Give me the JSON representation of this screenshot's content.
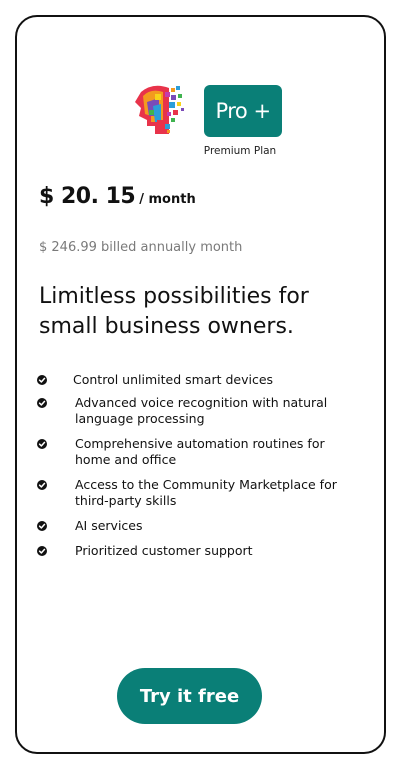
{
  "plan": {
    "badge_label": "Pro +",
    "caption": "Premium Plan"
  },
  "pricing": {
    "amount": "$ 20. 15",
    "period": "/ month",
    "billed": "$ 246.99 billed annually month"
  },
  "headline": "Limitless possibilities for small business owners.",
  "features": [
    "Control unlimited smart devices",
    "Advanced voice recognition with natural language processing",
    "Comprehensive automation routines for home and office",
    "Access to the Community Marketplace for third-party skills",
    "AI services",
    "Prioritized customer support"
  ],
  "cta": {
    "label": "Try it free"
  },
  "colors": {
    "accent": "#0a7f77",
    "text": "#111111",
    "muted": "#7a7a7a"
  },
  "icons": {
    "logo": "ai-head-logo-icon",
    "bullet": "check-circle-icon"
  }
}
